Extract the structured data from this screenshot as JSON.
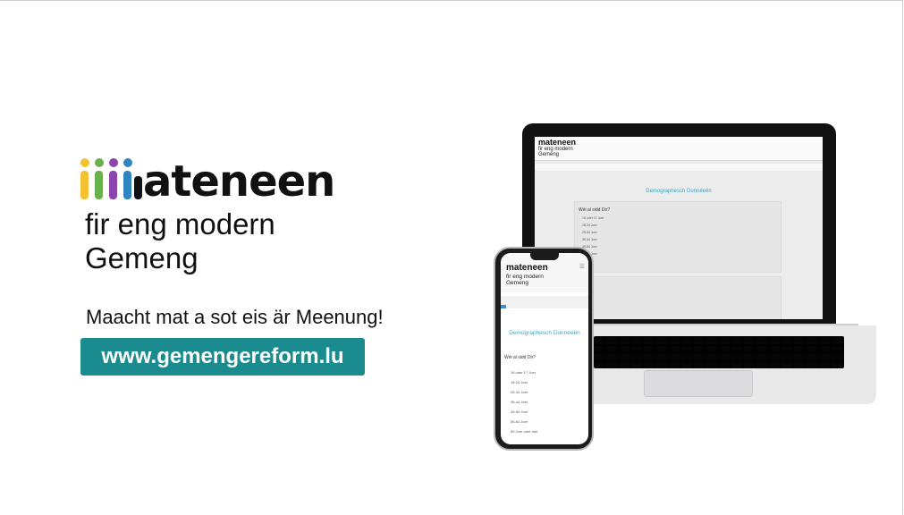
{
  "brand": {
    "wordmark": "ateneen",
    "tagline_line1": "fir eng modern",
    "tagline_line2": "Gemeng",
    "cta": "Maacht mat a sot eis är Meenung!",
    "url": "www.gemengereform.lu",
    "colors": {
      "teal": "#1a8c90",
      "yellow": "#f2c230",
      "green": "#6ab04c",
      "purple": "#8e44ad",
      "blue": "#2e86c1"
    }
  },
  "laptop_screen": {
    "logo": "mateneen",
    "sub_line1": "fir eng modern",
    "sub_line2": "Gemeng",
    "section_title": "Demographesch Donnéeën",
    "question": "Wéi al sidd Dir?",
    "options": [
      "16 oder 17 Joer",
      "18-24 Joer",
      "25-34 Joer",
      "35-44 Joer",
      "45-54 Joer",
      "55-64 Joer"
    ]
  },
  "phone_screen": {
    "logo": "mateneen",
    "sub_line1": "fir eng modern",
    "sub_line2": "Gemeng",
    "menu_icon": "menu-icon",
    "section_title": "Demographesch Donnéeën",
    "question": "Wéi al sidd Dir?",
    "options": [
      "16 oder 17 Joer",
      "18-24 Joer",
      "25-34 Joer",
      "35-44 Joer",
      "45-54 Joer",
      "55-64 Joer",
      "65 Joer oder méi"
    ]
  }
}
